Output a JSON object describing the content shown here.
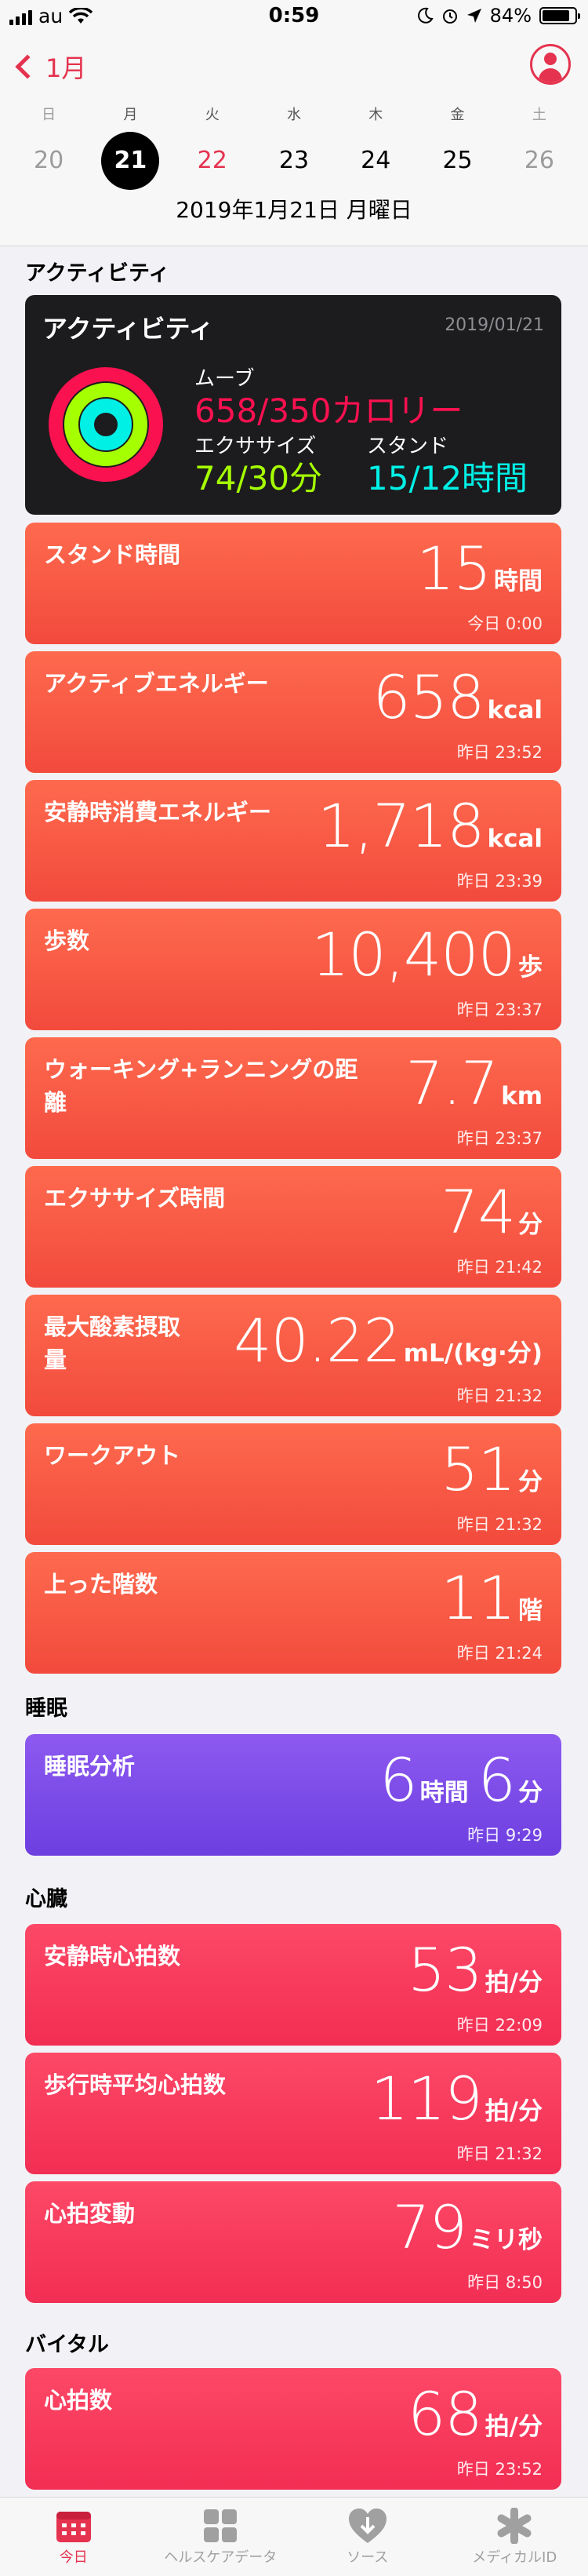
{
  "status": {
    "carrier": "au",
    "time": "0:59",
    "battery": "84%",
    "battery_level": 0.84
  },
  "nav": {
    "back_label": "1月",
    "week": [
      {
        "dow": "日",
        "num": "20",
        "kind": "weekend"
      },
      {
        "dow": "月",
        "num": "21",
        "kind": "today"
      },
      {
        "dow": "火",
        "num": "22",
        "kind": "red"
      },
      {
        "dow": "水",
        "num": "23",
        "kind": "normal"
      },
      {
        "dow": "木",
        "num": "24",
        "kind": "normal"
      },
      {
        "dow": "金",
        "num": "25",
        "kind": "normal"
      },
      {
        "dow": "土",
        "num": "26",
        "kind": "weekend"
      }
    ],
    "full_date": "2019年1月21日 月曜日"
  },
  "activity_section": {
    "title": "アクティビティ",
    "card": {
      "title": "アクティビティ",
      "date": "2019/01/21",
      "move_label": "ムーブ",
      "move_value": "658/350カロリー",
      "exercise_label": "エクササイズ",
      "exercise_value": "74/30分",
      "stand_label": "スタンド",
      "stand_value": "15/12時間",
      "colors": {
        "move": "#fa1150",
        "exercise": "#a6ff00",
        "stand": "#00f0e6"
      }
    },
    "metrics": [
      {
        "title": "スタンド時間",
        "value": "15",
        "unit": "時間",
        "time": "今日 0:00"
      },
      {
        "title": "アクティブエネルギー",
        "value": "658",
        "unit": "kcal",
        "time": "昨日 23:52"
      },
      {
        "title": "安静時消費エネルギー",
        "value": "1,718",
        "unit": "kcal",
        "time": "昨日 23:39"
      },
      {
        "title": "歩数",
        "value": "10,400",
        "unit": "歩",
        "time": "昨日 23:37"
      },
      {
        "title": "ウォーキング+ランニングの距離",
        "value": "7.7",
        "unit": "km",
        "time": "昨日 23:37"
      },
      {
        "title": "エクササイズ時間",
        "value": "74",
        "unit": "分",
        "time": "昨日 21:42"
      },
      {
        "title": "最大酸素摂取量",
        "value": "40.22",
        "unit": "mL/(kg·分)",
        "time": "昨日 21:32"
      },
      {
        "title": "ワークアウト",
        "value": "51",
        "unit": "分",
        "time": "昨日 21:32"
      },
      {
        "title": "上った階数",
        "value": "11",
        "unit": "階",
        "time": "昨日 21:24"
      }
    ]
  },
  "sleep_section": {
    "title": "睡眠",
    "metrics": [
      {
        "title": "睡眠分析",
        "value": "6",
        "unit": "時間",
        "value2": "6",
        "unit2": "分",
        "time": "昨日 9:29"
      }
    ]
  },
  "heart_section": {
    "title": "心臓",
    "metrics": [
      {
        "title": "安静時心拍数",
        "value": "53",
        "unit": "拍/分",
        "time": "昨日 22:09"
      },
      {
        "title": "歩行時平均心拍数",
        "value": "119",
        "unit": "拍/分",
        "time": "昨日 21:32"
      },
      {
        "title": "心拍変動",
        "value": "79",
        "unit": "ミリ秒",
        "time": "昨日 8:50"
      }
    ]
  },
  "vitals_section": {
    "title": "バイタル",
    "metrics": [
      {
        "title": "心拍数",
        "value": "68",
        "unit": "拍/分",
        "time": "昨日 23:52"
      }
    ]
  },
  "tabbar": [
    {
      "label": "今日",
      "icon": "calendar-icon",
      "active": true
    },
    {
      "label": "ヘルスケアデータ",
      "icon": "grid-icon",
      "active": false
    },
    {
      "label": "ソース",
      "icon": "heart-download-icon",
      "active": false
    },
    {
      "label": "メディカルID",
      "icon": "asterisk-icon",
      "active": false
    }
  ]
}
